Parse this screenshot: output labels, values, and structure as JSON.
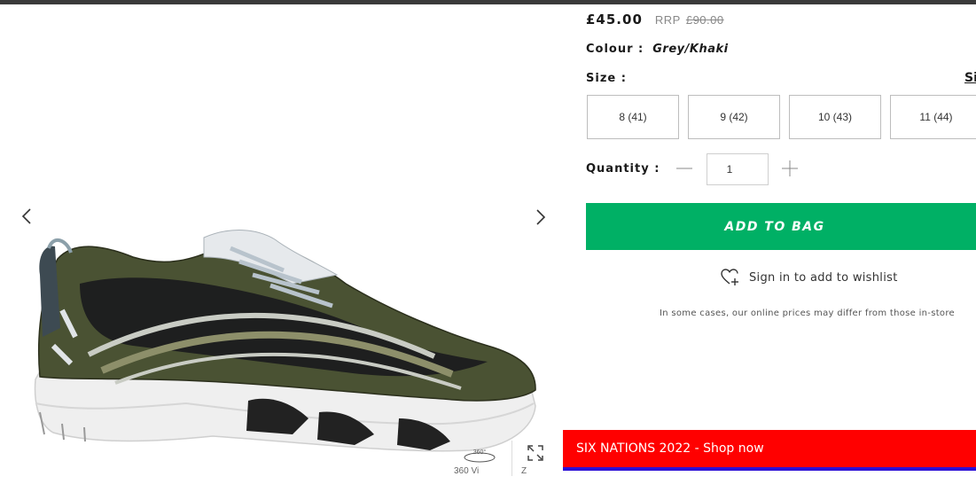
{
  "product": {
    "price": "£45.00",
    "rrp_label": "RRP",
    "rrp_value": "£90.00",
    "colour_label": "Colour :",
    "colour_value": "Grey/Khaki",
    "size_label": "Size :",
    "size_guide_label": "Si",
    "sizes": [
      {
        "label": "8 (41)"
      },
      {
        "label": "9 (42)"
      },
      {
        "label": "10 (43)"
      },
      {
        "label": "11 (44)"
      }
    ],
    "quantity_label": "Quantity :",
    "quantity_value": "1",
    "add_to_bag_label": "ADD TO BAG",
    "wishlist_label": "Sign in to add to wishlist",
    "disclaimer": "In some cases, our online prices may differ from those in-store"
  },
  "gallery": {
    "view_360_badge": "360°",
    "view_caption": "360 Vi",
    "zoom_caption": "Z"
  },
  "promo": {
    "text": "SIX NATIONS 2022 - Shop now"
  },
  "colors": {
    "accent_green": "#00b065",
    "promo_red": "#ff0000",
    "promo_underline": "#2b0fd6"
  },
  "icons": [
    "chevron-left-icon",
    "chevron-right-icon",
    "minus-icon",
    "plus-icon",
    "heart-plus-icon",
    "view-360-icon",
    "expand-icon"
  ]
}
